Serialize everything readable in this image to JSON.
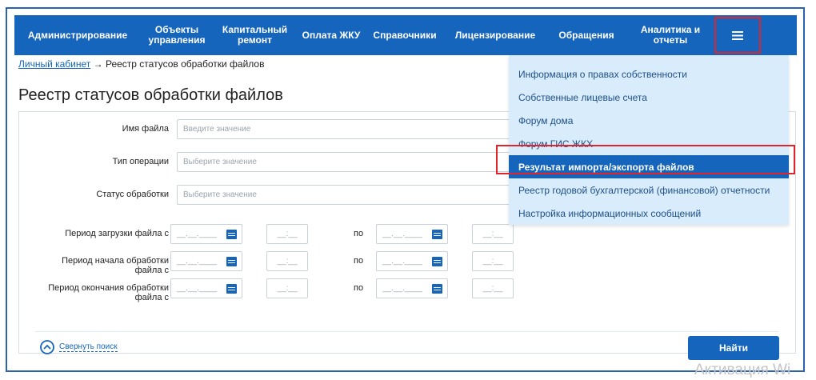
{
  "nav": {
    "items": [
      {
        "label": "Администрирование"
      },
      {
        "label": "Объекты управления"
      },
      {
        "label": "Капитальный ремонт"
      },
      {
        "label": "Оплата ЖКУ"
      },
      {
        "label": "Справочники"
      },
      {
        "label": "Лицензирование"
      },
      {
        "label": "Обращения"
      },
      {
        "label": "Аналитика и отчеты"
      }
    ],
    "menu_icon": "hamburger-icon"
  },
  "breadcrumb": {
    "link": "Личный кабинет",
    "separator": "→",
    "current": "Реестр статусов обработки файлов"
  },
  "page_title": "Реестр статусов обработки файлов",
  "form": {
    "file_name_label": "Имя файла",
    "file_name_placeholder": "Введите значение",
    "operation_type_label": "Тип операции",
    "operation_type_placeholder": "Выберите значение",
    "processing_status_label": "Статус обработки",
    "processing_status_placeholder": "Выберите значение",
    "upload_period_label": "Период загрузки файла с",
    "processing_start_period_label": "Период начала обработки файла с",
    "processing_end_period_label": "Период окончания обработки файла с",
    "to_label": "по",
    "date_placeholder": "__.__.____",
    "time_placeholder": "__:__",
    "collapse_label": "Свернуть поиск",
    "find_button": "Найти"
  },
  "dropdown": {
    "items": [
      {
        "label": "Информация о правах собственности"
      },
      {
        "label": "Собственные лицевые счета"
      },
      {
        "label": "Форум дома"
      },
      {
        "label": "Форум ГИС ЖКХ"
      },
      {
        "label": "Результат импорта/экспорта файлов",
        "active": true
      },
      {
        "label": "Реестр годовой бухгалтерской (финансовой) отчетности"
      },
      {
        "label": "Настройка информационных сообщений"
      }
    ]
  },
  "watermark": "Активация Wi",
  "colors": {
    "nav_bg": "#1565bd",
    "dropdown_bg": "#d8ecfb",
    "active_item_bg": "#1565bd",
    "highlight_border": "#e0242b"
  }
}
